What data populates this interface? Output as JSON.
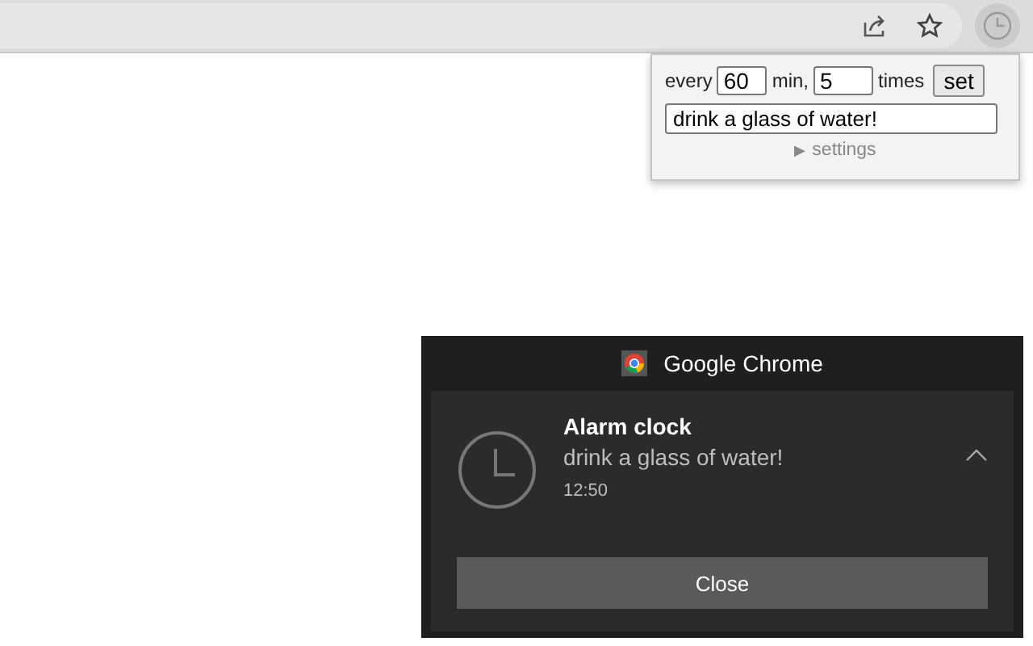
{
  "popup": {
    "every_label": "every",
    "interval": "60",
    "min_label": "min,",
    "count": "5",
    "times_label": "times",
    "set_button": "set",
    "message": "drink a glass of water!",
    "settings_toggle": "▶",
    "settings_label": "settings",
    "settings_expanded": false
  },
  "notification": {
    "app": "Google Chrome",
    "title": "Alarm clock",
    "message": "drink a glass of water!",
    "time": "12:50",
    "button": "Close"
  }
}
